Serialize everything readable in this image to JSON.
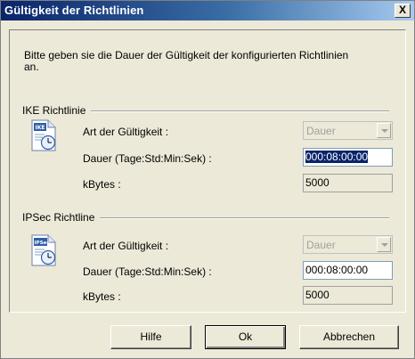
{
  "window": {
    "title": "Gültigkeit der Richtlinien",
    "close_label": "X"
  },
  "description": "Bitte geben sie die Dauer der Gültigkeit der konfigurierten Richtlinien an.",
  "ike": {
    "group_label": "IKE Richtlinie",
    "icon_text": "IKE",
    "validity_type_label": "Art der Gültigkeit :",
    "validity_type_value": "Dauer",
    "duration_label": "Dauer (Tage:Std:Min:Sek) :",
    "duration_value": "000:08:00:00",
    "kbytes_label": "kBytes :",
    "kbytes_value": "5000"
  },
  "ipsec": {
    "group_label": "IPSec Richtline",
    "icon_text": "IPSec",
    "validity_type_label": "Art der Gültigkeit :",
    "validity_type_value": "Dauer",
    "duration_label": "Dauer (Tage:Std:Min:Sek) :",
    "duration_value": "000:08:00:00",
    "kbytes_label": "kBytes :",
    "kbytes_value": "5000"
  },
  "buttons": {
    "help": "Hilfe",
    "ok": "Ok",
    "cancel": "Abbrechen"
  }
}
